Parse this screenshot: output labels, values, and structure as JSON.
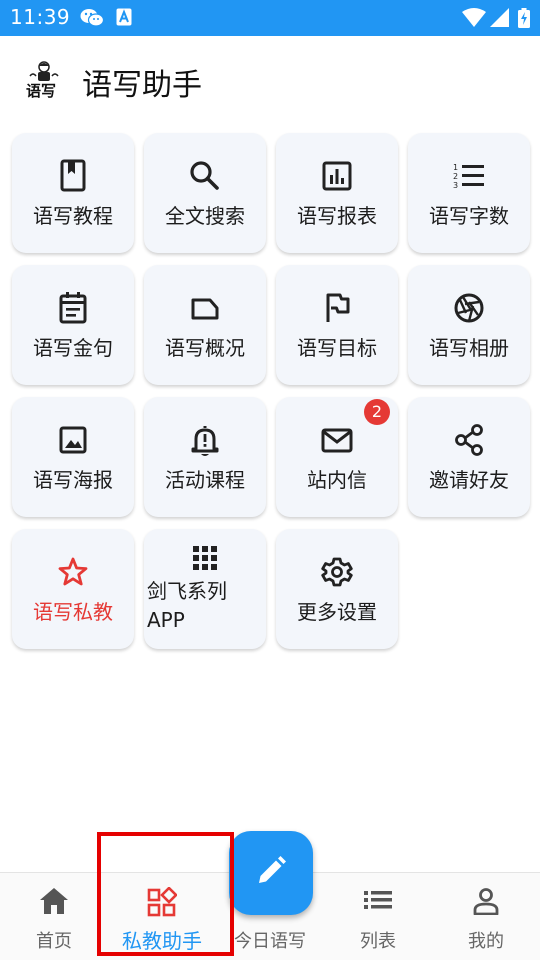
{
  "status_bar": {
    "time": "11:39",
    "background": "#2196F3",
    "icons": [
      "wechat-icon",
      "a-icon",
      "wifi-icon",
      "signal-icon",
      "battery-icon"
    ]
  },
  "header": {
    "logo_text": "语写",
    "title": "语写助手"
  },
  "grid": {
    "tiles": [
      {
        "label": "语写教程",
        "icon": "book-icon"
      },
      {
        "label": "全文搜索",
        "icon": "search-icon"
      },
      {
        "label": "语写报表",
        "icon": "bar-chart-icon"
      },
      {
        "label": "语写字数",
        "icon": "numbered-list-icon"
      },
      {
        "label": "语写金句",
        "icon": "calendar-note-icon"
      },
      {
        "label": "语写概况",
        "icon": "label-icon"
      },
      {
        "label": "语写目标",
        "icon": "flag-icon"
      },
      {
        "label": "语写相册",
        "icon": "camera-shutter-icon"
      },
      {
        "label": "语写海报",
        "icon": "image-icon"
      },
      {
        "label": "活动课程",
        "icon": "bell-alert-icon"
      },
      {
        "label": "站内信",
        "icon": "mail-icon",
        "badge": "2"
      },
      {
        "label": "邀请好友",
        "icon": "share-icon"
      },
      {
        "label": "语写私教",
        "icon": "star-icon",
        "color": "#e53935"
      },
      {
        "label": "剑飞系列APP",
        "icon": "apps-grid-icon"
      },
      {
        "label": "更多设置",
        "icon": "gear-icon"
      }
    ]
  },
  "bottom_nav": {
    "items": [
      {
        "label": "首页",
        "icon": "home-icon"
      },
      {
        "label": "私教助手",
        "icon": "dashboard-icon",
        "active": true
      },
      {
        "label": "今日语写",
        "icon": "pencil-icon"
      },
      {
        "label": "列表",
        "icon": "list-icon"
      },
      {
        "label": "我的",
        "icon": "person-icon"
      }
    ],
    "active_color": "#2196F3"
  }
}
